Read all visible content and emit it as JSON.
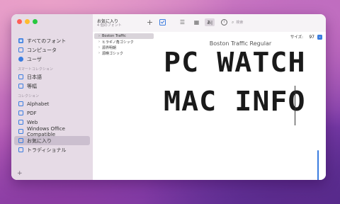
{
  "sidebar": {
    "top_items": [
      {
        "label": "すべてのフォント",
        "icon": "all-fonts-icon"
      },
      {
        "label": "コンピュータ",
        "icon": "computer-icon"
      },
      {
        "label": "ユーザ",
        "icon": "user-icon"
      }
    ],
    "smart_collections_header": "スマートコレクション",
    "smart_items": [
      {
        "label": "日本語",
        "icon": "smart-collection-icon"
      },
      {
        "label": "等幅",
        "icon": "smart-collection-icon"
      }
    ],
    "collections_header": "コレクション",
    "collection_items": [
      {
        "label": "Alphabet",
        "icon": "collection-icon"
      },
      {
        "label": "PDF",
        "icon": "collection-icon"
      },
      {
        "label": "Web",
        "icon": "collection-icon"
      },
      {
        "label": "Windows Office Compatible",
        "icon": "collection-icon"
      },
      {
        "label": "お気に入り",
        "icon": "collection-icon",
        "selected": true
      },
      {
        "label": "トラディショナル",
        "icon": "collection-icon"
      }
    ],
    "add_label": "+"
  },
  "toolbar": {
    "title": "お気に入り",
    "subtitle": "4 個のフォント",
    "add_glyph": "+",
    "sample_glyph": "あ|",
    "info_glyph": "i",
    "search_placeholder": "検索"
  },
  "font_list": [
    {
      "label": "Boston Traffic",
      "selected": true
    },
    {
      "label": "ヒラギノ角ゴシック"
    },
    {
      "label": "源界明朝"
    },
    {
      "label": "源暎ゴシック"
    }
  ],
  "preview": {
    "size_label": "サイズ:",
    "size_value": "97",
    "font_name": "Boston Traffic Regular",
    "sample_line_1": "PC WATCH",
    "sample_line_2": "MAC INFO"
  },
  "colors": {
    "accent": "#3b7de0",
    "sidebar_bg": "#e6dbe6"
  }
}
